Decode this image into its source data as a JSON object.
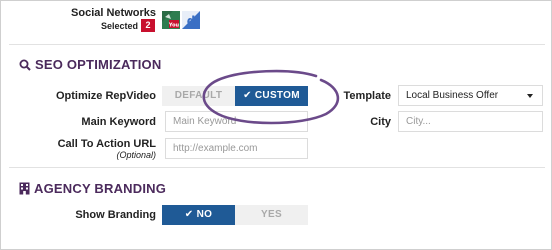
{
  "social": {
    "label": "Social Networks",
    "selected_label": "Selected",
    "selected_count": "2",
    "networks": [
      {
        "icon": "youtube-network-icon",
        "color": "#2e7d4f"
      },
      {
        "icon": "delicious-network-icon",
        "color": "#3a6fc4"
      }
    ]
  },
  "seo": {
    "title": "SEO OPTIMIZATION",
    "optimize_label": "Optimize RepVideo",
    "default_label": "DEFAULT",
    "custom_label": "CUSTOM",
    "template_label": "Template",
    "template_value": "Local Business Offer",
    "keyword_label": "Main Keyword",
    "keyword_placeholder": "Main Keyword",
    "city_label": "City",
    "city_placeholder": "City...",
    "cta_label": "Call To Action URL",
    "cta_optional": "(Optional)",
    "cta_placeholder": "http://example.com"
  },
  "agency": {
    "title": "AGENCY BRANDING",
    "branding_label": "Show Branding",
    "no_label": "NO",
    "yes_label": "YES"
  },
  "colors": {
    "accent": "#1f5a96",
    "section_title": "#4b2a5c",
    "annotation_circle": "#6b4a8a",
    "badge": "#c8102e"
  }
}
